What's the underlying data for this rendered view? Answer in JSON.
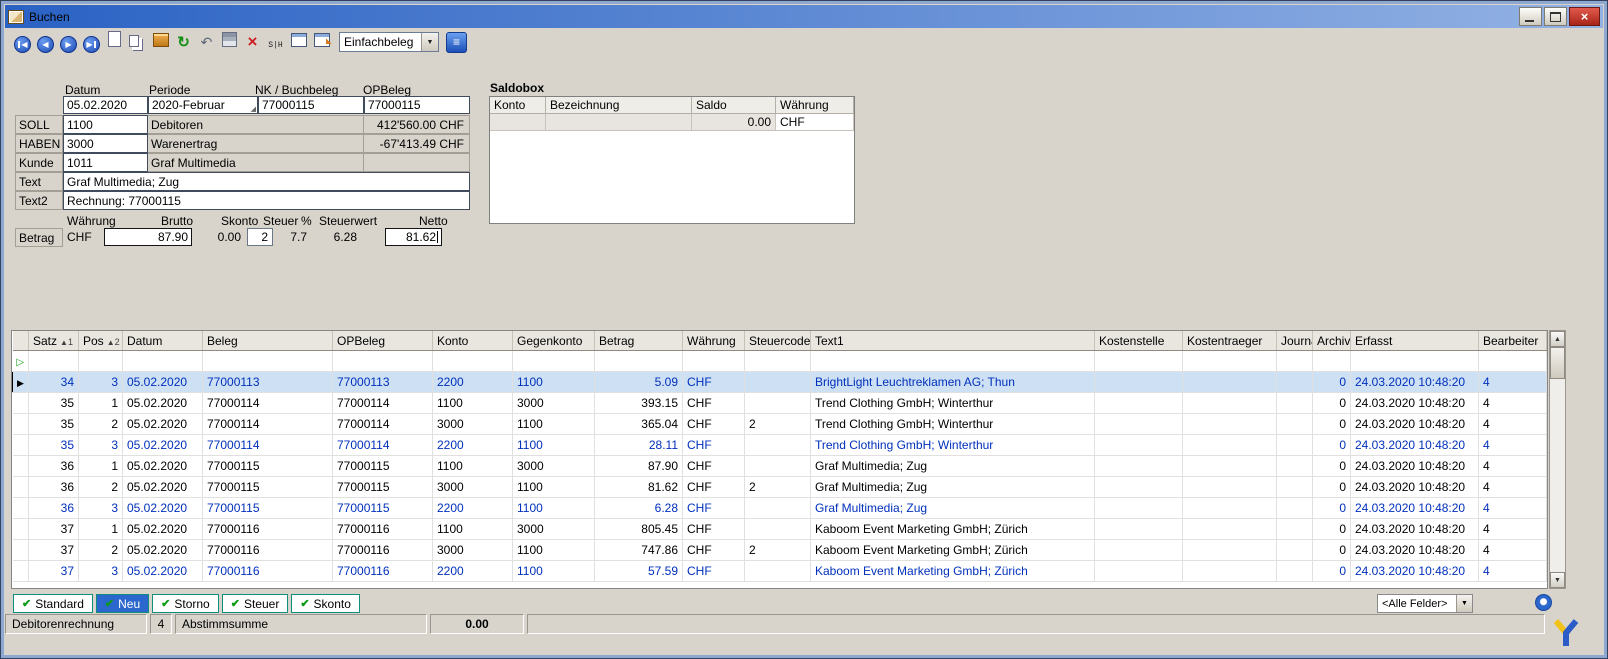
{
  "window": {
    "title": "Buchen"
  },
  "toolbar": {
    "icons_left": [
      "first-record",
      "previous-record",
      "next-record",
      "last-record",
      "new-document",
      "copy",
      "post-package",
      "refresh",
      "undo",
      "save",
      "delete",
      "soll-haben",
      "properties",
      "assign"
    ],
    "doc_type": "Einfachbeleg",
    "icons_right": [
      "table-link"
    ]
  },
  "form": {
    "col_headers": {
      "datum": "Datum",
      "periode": "Periode",
      "nk_buchbeleg": "NK / Buchbeleg",
      "opbeleg": "OPBeleg"
    },
    "fields": {
      "datum": "05.02.2020",
      "periode": "2020-Februar",
      "nk_buchbeleg": "77000115",
      "opbeleg": "77000115"
    },
    "rows": [
      {
        "label": "SOLL",
        "konto": "1100",
        "bezeichnung": "Debitoren",
        "saldo": "412'560.00 CHF"
      },
      {
        "label": "HABEN",
        "konto": "3000",
        "bezeichnung": "Warenertrag",
        "saldo": "-67'413.49 CHF"
      },
      {
        "label": "Kunde",
        "konto": "1011",
        "bezeichnung": "Graf Multimedia",
        "saldo": ""
      }
    ],
    "text_label": "Text",
    "text_value": "Graf Multimedia; Zug",
    "text2_label": "Text2",
    "text2_value": "Rechnung: 77000115",
    "amount_headers": {
      "waehrung": "Währung",
      "brutto": "Brutto",
      "skonto": "Skonto",
      "steuer": "Steuer",
      "prozent": "%",
      "steuerwert": "Steuerwert",
      "netto": "Netto"
    },
    "betrag_label": "Betrag",
    "betrag": {
      "waehrung": "CHF",
      "brutto": "87.90",
      "skonto": "0.00",
      "steuer": "2",
      "prozent": "7.7",
      "steuerwert": "6.28",
      "netto": "81.62"
    }
  },
  "saldobox": {
    "title": "Saldobox",
    "columns": [
      "Konto",
      "Bezeichnung",
      "Saldo",
      "Währung"
    ],
    "rows": [
      [
        "",
        "",
        "0.00",
        "CHF"
      ]
    ]
  },
  "grid": {
    "columns": [
      {
        "label": "Satz",
        "sort": "1"
      },
      {
        "label": "Pos",
        "sort": "2"
      },
      {
        "label": "Datum"
      },
      {
        "label": "Beleg"
      },
      {
        "label": "OPBeleg"
      },
      {
        "label": "Konto"
      },
      {
        "label": "Gegenkonto"
      },
      {
        "label": "Betrag"
      },
      {
        "label": "Währung"
      },
      {
        "label": "Steuercode"
      },
      {
        "label": "Text1"
      },
      {
        "label": "Kostenstelle"
      },
      {
        "label": "Kostentraeger"
      },
      {
        "label": "Journal"
      },
      {
        "label": "Archiv"
      },
      {
        "label": "Erfasst"
      },
      {
        "label": "Bearbeiter"
      }
    ],
    "rows": [
      {
        "insert": true,
        "cells": [
          "",
          "",
          "",
          "",
          "",
          "",
          "",
          "",
          "",
          "",
          "",
          "",
          "",
          "",
          "",
          "",
          ""
        ]
      },
      {
        "selected": true,
        "blue": true,
        "cells": [
          "34",
          "3",
          "05.02.2020",
          "77000113",
          "77000113",
          "2200",
          "1100",
          "5.09",
          "CHF",
          "",
          "BrightLight Leuchtreklamen AG; Thun",
          "",
          "",
          "",
          "0",
          "24.03.2020 10:48:20",
          "4"
        ]
      },
      {
        "cells": [
          "35",
          "1",
          "05.02.2020",
          "77000114",
          "77000114",
          "1100",
          "3000",
          "393.15",
          "CHF",
          "",
          "Trend Clothing GmbH; Winterthur",
          "",
          "",
          "",
          "0",
          "24.03.2020 10:48:20",
          "4"
        ]
      },
      {
        "cells": [
          "35",
          "2",
          "05.02.2020",
          "77000114",
          "77000114",
          "3000",
          "1100",
          "365.04",
          "CHF",
          "2",
          "Trend Clothing GmbH; Winterthur",
          "",
          "",
          "",
          "0",
          "24.03.2020 10:48:20",
          "4"
        ]
      },
      {
        "blue": true,
        "cells": [
          "35",
          "3",
          "05.02.2020",
          "77000114",
          "77000114",
          "2200",
          "1100",
          "28.11",
          "CHF",
          "",
          "Trend Clothing GmbH; Winterthur",
          "",
          "",
          "",
          "0",
          "24.03.2020 10:48:20",
          "4"
        ]
      },
      {
        "cells": [
          "36",
          "1",
          "05.02.2020",
          "77000115",
          "77000115",
          "1100",
          "3000",
          "87.90",
          "CHF",
          "",
          "Graf Multimedia; Zug",
          "",
          "",
          "",
          "0",
          "24.03.2020 10:48:20",
          "4"
        ]
      },
      {
        "cells": [
          "36",
          "2",
          "05.02.2020",
          "77000115",
          "77000115",
          "3000",
          "1100",
          "81.62",
          "CHF",
          "2",
          "Graf Multimedia; Zug",
          "",
          "",
          "",
          "0",
          "24.03.2020 10:48:20",
          "4"
        ]
      },
      {
        "blue": true,
        "cells": [
          "36",
          "3",
          "05.02.2020",
          "77000115",
          "77000115",
          "2200",
          "1100",
          "6.28",
          "CHF",
          "",
          "Graf Multimedia; Zug",
          "",
          "",
          "",
          "0",
          "24.03.2020 10:48:20",
          "4"
        ]
      },
      {
        "cells": [
          "37",
          "1",
          "05.02.2020",
          "77000116",
          "77000116",
          "1100",
          "3000",
          "805.45",
          "CHF",
          "",
          "Kaboom Event Marketing GmbH; Zürich",
          "",
          "",
          "",
          "0",
          "24.03.2020 10:48:20",
          "4"
        ]
      },
      {
        "cells": [
          "37",
          "2",
          "05.02.2020",
          "77000116",
          "77000116",
          "3000",
          "1100",
          "747.86",
          "CHF",
          "2",
          "Kaboom Event Marketing GmbH; Zürich",
          "",
          "",
          "",
          "0",
          "24.03.2020 10:48:20",
          "4"
        ]
      },
      {
        "blue": true,
        "cells": [
          "37",
          "3",
          "05.02.2020",
          "77000116",
          "77000116",
          "2200",
          "1100",
          "57.59",
          "CHF",
          "",
          "Kaboom Event Marketing GmbH; Zürich",
          "",
          "",
          "",
          "0",
          "24.03.2020 10:48:20",
          "4"
        ]
      }
    ]
  },
  "footer": {
    "buttons": [
      {
        "label": "Standard"
      },
      {
        "label": "Neu",
        "active": true
      },
      {
        "label": "Storno"
      },
      {
        "label": "Steuer"
      },
      {
        "label": "Skonto"
      }
    ],
    "field_filter": "<Alle Felder>"
  },
  "statusbar": {
    "mode": "Debitorenrechnung",
    "count": "4",
    "abstimm_label": "Abstimmsumme",
    "abstimm_value": "0.00"
  },
  "colors": {
    "accent_blue": "#2a66cc",
    "row_blue_text": "#0030bc",
    "selection_bg": "#cde0f4",
    "close_red": "#b02820",
    "check_green": "#0a9a14"
  }
}
